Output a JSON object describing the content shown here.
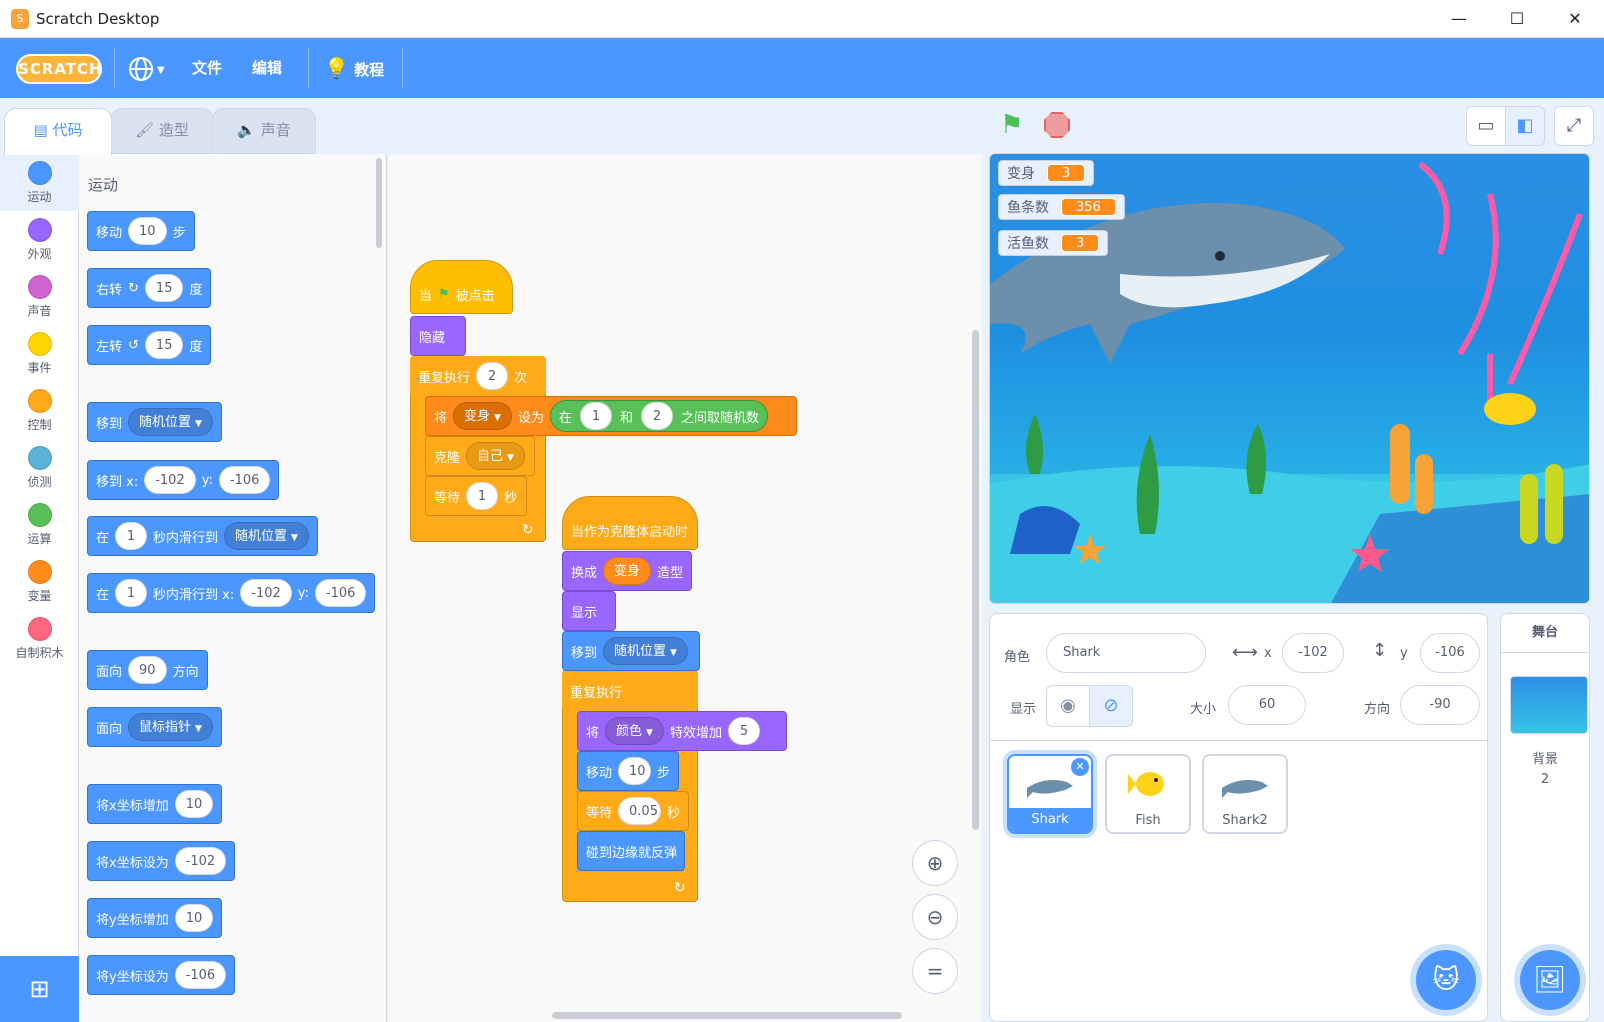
{
  "window": {
    "title": "Scratch Desktop",
    "minimize": "—",
    "maximize": "☐",
    "close": "✕"
  },
  "menu": {
    "logo": "SCRATCH",
    "language_icon": "globe-icon",
    "file": "文件",
    "edit": "编辑",
    "tutorials": "教程"
  },
  "tabs": {
    "code": "代码",
    "costumes": "造型",
    "sounds": "声音"
  },
  "categories": [
    {
      "label": "运动",
      "color": "#4c97ff"
    },
    {
      "label": "外观",
      "color": "#9966ff"
    },
    {
      "label": "声音",
      "color": "#cf63cf"
    },
    {
      "label": "事件",
      "color": "#ffd500"
    },
    {
      "label": "控制",
      "color": "#ffab19"
    },
    {
      "label": "侦测",
      "color": "#5cb1d6"
    },
    {
      "label": "运算",
      "color": "#59c059"
    },
    {
      "label": "变量",
      "color": "#ff8c1a"
    },
    {
      "label": "自制积木",
      "color": "#ff6680"
    }
  ],
  "palette": {
    "title": "运动",
    "move": {
      "a": "移动",
      "v": "10",
      "b": "步"
    },
    "turn_right": {
      "a": "右转",
      "v": "15",
      "b": "度"
    },
    "turn_left": {
      "a": "左转",
      "v": "15",
      "b": "度"
    },
    "goto": {
      "a": "移到",
      "dd": "随机位置"
    },
    "goto_xy": {
      "a": "移到 x:",
      "x": "-102",
      "ylab": "y:",
      "y": "-106"
    },
    "glide": {
      "a": "在",
      "v": "1",
      "b": "秒内滑行到",
      "dd": "随机位置"
    },
    "glide_xy": {
      "a": "在",
      "v": "1",
      "b": "秒内滑行到 x:",
      "x": "-102",
      "ylab": "y:",
      "y": "-106"
    },
    "point_dir": {
      "a": "面向",
      "v": "90",
      "b": "方向"
    },
    "point_towards": {
      "a": "面向",
      "dd": "鼠标指针"
    },
    "change_x": {
      "a": "将x坐标增加",
      "v": "10"
    },
    "set_x": {
      "a": "将x坐标设为",
      "v": "-102"
    },
    "change_y": {
      "a": "将y坐标增加",
      "v": "10"
    },
    "set_y": {
      "a": "将y坐标设为",
      "v": "-106"
    }
  },
  "script1": {
    "hat": {
      "a": "当",
      "b": "被点击"
    },
    "hide": "隐藏",
    "repeat": {
      "a": "重复执行",
      "v": "2",
      "b": "次"
    },
    "setvar": {
      "a": "将",
      "dd": "变身",
      "b": "设为",
      "c": "在",
      "v1": "1",
      "d": "和",
      "v2": "2",
      "e": "之间取随机数"
    },
    "clone": {
      "a": "克隆",
      "dd": "自己"
    },
    "wait": {
      "a": "等待",
      "v": "1",
      "b": "秒"
    }
  },
  "script2": {
    "hat": "当作为克隆体启动时",
    "switch": {
      "a": "换成",
      "r": "变身",
      "b": "造型"
    },
    "show": "显示",
    "goto": {
      "a": "移到",
      "dd": "随机位置"
    },
    "forever": "重复执行",
    "effect": {
      "a": "将",
      "dd": "颜色",
      "b": "特效增加",
      "v": "5"
    },
    "move": {
      "a": "移动",
      "v": "10",
      "b": "步"
    },
    "wait": {
      "a": "等待",
      "v": "0.05",
      "b": "秒"
    },
    "bounce": "碰到边缘就反弹"
  },
  "monitors": [
    {
      "label": "变身",
      "value": "3"
    },
    {
      "label": "鱼条数",
      "value": "356"
    },
    {
      "label": "活鱼数",
      "value": "3"
    }
  ],
  "sprite_info": {
    "sprite_label": "角色",
    "sprite_name": "Shark",
    "x_label": "x",
    "x": "-102",
    "y_label": "y",
    "y": "-106",
    "show_label": "显示",
    "size_label": "大小",
    "size": "60",
    "dir_label": "方向",
    "direction": "-90"
  },
  "sprites": [
    {
      "name": "Shark",
      "selected": true
    },
    {
      "name": "Fish",
      "selected": false
    },
    {
      "name": "Shark2",
      "selected": false
    }
  ],
  "stage_pane": {
    "title": "舞台",
    "backdrop_label": "背景",
    "backdrop_count": "2"
  }
}
